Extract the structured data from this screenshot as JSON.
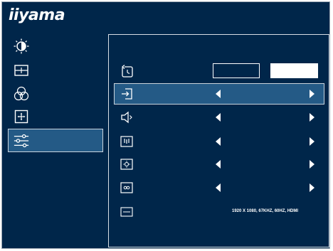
{
  "brand": {
    "logo_text": "iiyama"
  },
  "sidebar": {
    "items": [
      {
        "icon": "brightness-icon"
      },
      {
        "icon": "picture-adjust-icon"
      },
      {
        "icon": "color-settings-icon"
      },
      {
        "icon": "position-icon"
      },
      {
        "icon": "setup-menu-icon",
        "selected": true
      }
    ]
  },
  "setup": {
    "rows": [
      {
        "icon": "reset-icon",
        "control": "buttons"
      },
      {
        "icon": "input-select-icon",
        "control": "arrows",
        "selected": true
      },
      {
        "icon": "volume-icon",
        "control": "arrows"
      },
      {
        "icon": "audio-input-icon",
        "control": "arrows"
      },
      {
        "icon": "led-icon",
        "control": "arrows"
      },
      {
        "icon": "osd-icon",
        "control": "arrows"
      },
      {
        "icon": "information-icon",
        "control": "text"
      }
    ],
    "info_text": "1920 X 1080, 67KHZ, 60HZ, HDMI"
  },
  "colors": {
    "background": "#00264a",
    "selected": "#245a86",
    "border": "#d8dee5",
    "foreground": "#ffffff"
  }
}
